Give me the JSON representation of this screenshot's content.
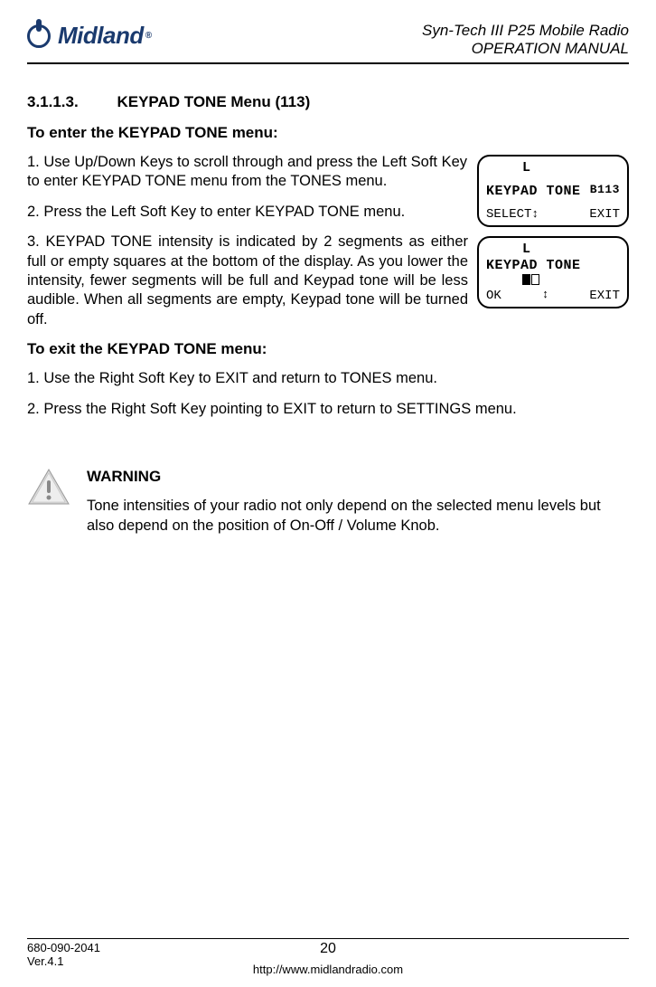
{
  "header": {
    "logo_text": "Midland",
    "title_line1": "Syn-Tech III P25 Mobile Radio",
    "title_line2": "OPERATION MANUAL"
  },
  "section": {
    "number": "3.1.1.3.",
    "title": "KEYPAD TONE Menu (113)"
  },
  "subheading_enter": "To enter the KEYPAD TONE menu:",
  "step1": "1. Use Up/Down Keys to scroll through and press the Left Soft Key to enter KEYPAD TONE menu from the TONES menu.",
  "step2": "2. Press the Left Soft Key to enter KEYPAD TONE menu.",
  "step3": "3. KEYPAD TONE intensity is indicated by 2 segments as either full or empty squares at the bottom of the display. As you lower the intensity, fewer segments will be full and Keypad tone will be less audible. When all segments are empty, Keypad tone will be turned off.",
  "subheading_exit": "To exit the KEYPAD TONE menu:",
  "exit1": "1. Use the Right Soft Key to EXIT and return to TONES menu.",
  "exit2": "2. Press the Right Soft Key pointing to EXIT to return to SETTINGS menu.",
  "lcd1": {
    "l_indicator": "L",
    "main_text": "KEYPAD TONE",
    "code": "B113",
    "left_soft": "SELECT",
    "arrows": "↕",
    "right_soft": "EXIT"
  },
  "lcd2": {
    "l_indicator": "L",
    "main_text": "KEYPAD TONE",
    "left_soft": "OK",
    "arrows": "↕",
    "right_soft": "EXIT"
  },
  "warning": {
    "heading": "WARNING",
    "body": "Tone intensities of your radio not only depend on the selected menu levels but also depend on the position of On-Off / Volume Knob."
  },
  "footer": {
    "doc_num": "680-090-2041",
    "version": "Ver.4.1",
    "page_num": "20",
    "url": "http://www.midlandradio.com"
  }
}
